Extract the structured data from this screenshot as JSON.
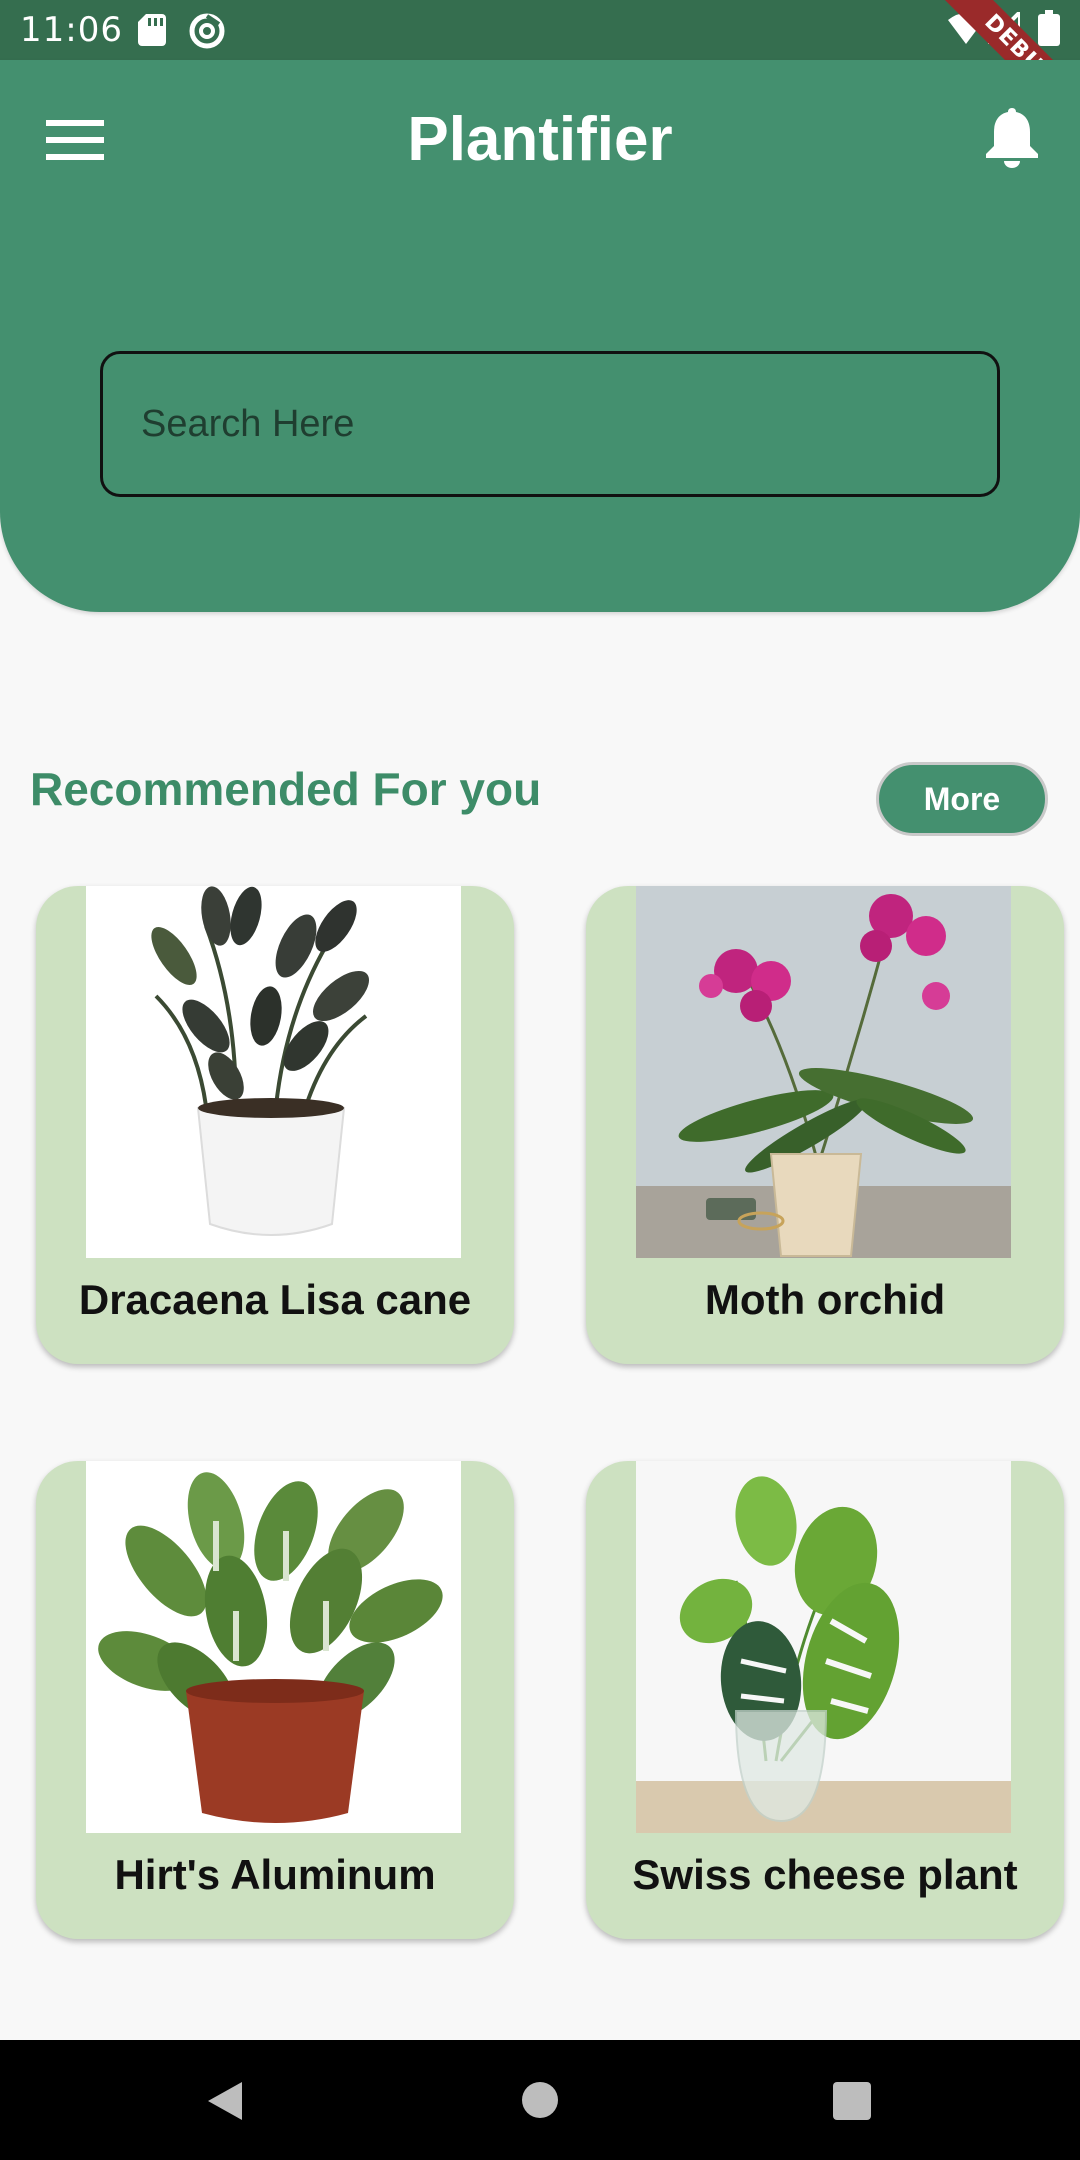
{
  "status_bar": {
    "time": "11:06",
    "debug_label": "DEBUG",
    "icons": [
      "sd-card-icon",
      "sync-icon",
      "wifi-icon",
      "signal-icon",
      "battery-icon"
    ]
  },
  "header": {
    "title": "Plantifier",
    "menu_icon": "menu-icon",
    "notification_icon": "bell-icon",
    "background_color": "#44906f"
  },
  "search": {
    "placeholder": "Search Here"
  },
  "recommended": {
    "title": "Recommended For you",
    "more_label": "More",
    "title_color": "#3d8c68",
    "card_color": "#cde1c1",
    "plants": [
      {
        "name": "Dracaena Lisa cane"
      },
      {
        "name": "Moth orchid"
      },
      {
        "name": "Hirt's Aluminum"
      },
      {
        "name": "Swiss cheese plant"
      }
    ]
  },
  "nav_bar": {
    "icons": [
      "back-icon",
      "home-icon",
      "recents-icon"
    ]
  }
}
